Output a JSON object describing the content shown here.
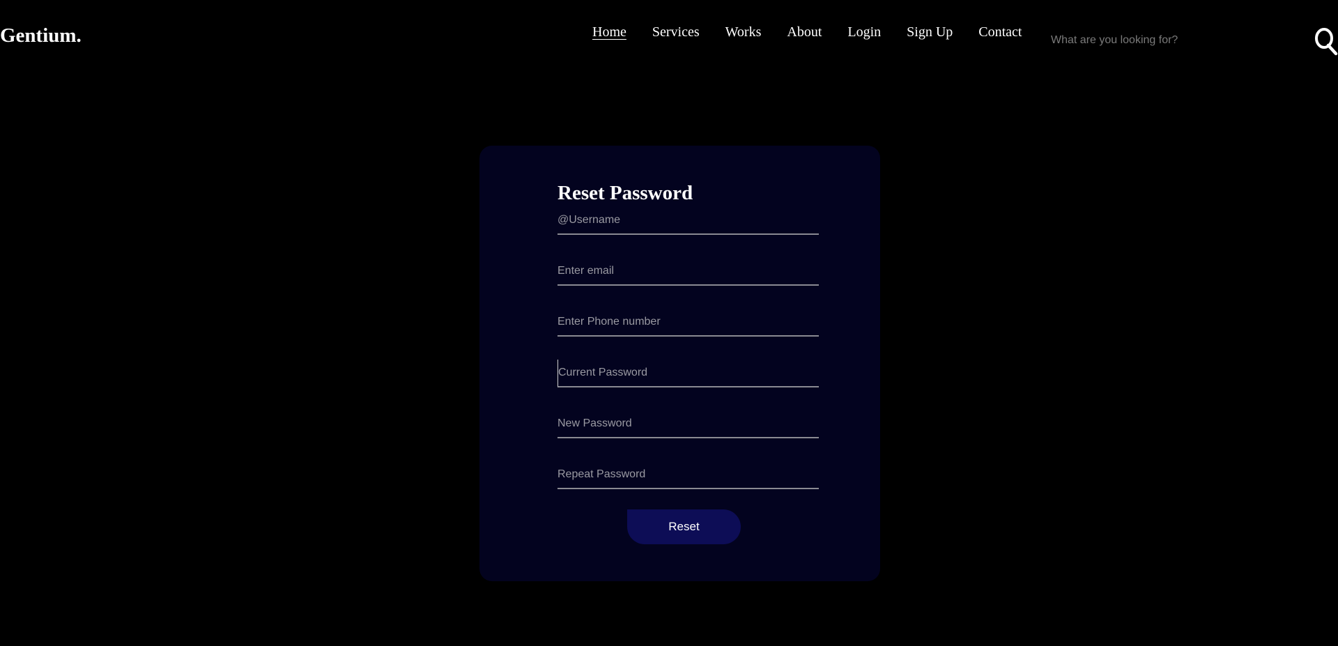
{
  "header": {
    "logo": "Gentium.",
    "nav": [
      "Home",
      "Services",
      "Works",
      "About",
      "Login",
      "Sign Up",
      "Contact"
    ],
    "active_nav": "Home",
    "search": {
      "placeholder": "What are you looking for?",
      "value": ""
    }
  },
  "form": {
    "title": "Reset Password",
    "fields": [
      {
        "placeholder": "@Username",
        "value": ""
      },
      {
        "placeholder": "Enter email",
        "value": ""
      },
      {
        "placeholder": "Enter Phone number",
        "value": ""
      },
      {
        "placeholder": "Current Password",
        "value": ""
      },
      {
        "placeholder": "New Password",
        "value": ""
      },
      {
        "placeholder": "Repeat Password",
        "value": ""
      }
    ],
    "focused_field": "Current Password",
    "submit_label": "Reset"
  },
  "colors": {
    "page_background": "#000000",
    "card_background": "#03031f",
    "button_background": "#0d0d56",
    "field_underline": "#8a8a92",
    "text": "#ffffff"
  },
  "icons": {
    "search": "search-icon"
  }
}
